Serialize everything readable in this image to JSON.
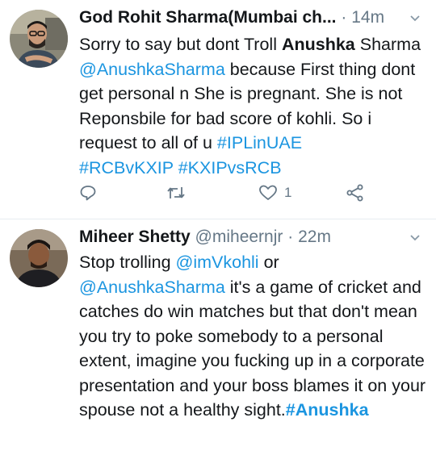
{
  "tweets": [
    {
      "name": "God Rohit Sharma(Mumbai ch...",
      "time": "14m",
      "separator": "·",
      "text": {
        "p1": "Sorry to say but dont Troll ",
        "bold1": "Anushka",
        "p2": " Sharma ",
        "mention1": "@AnushkaSharma",
        "p3": " because First thing dont get personal n She is pregnant. She is not Reponsbile for bad score of kohli. So i request to all of u ",
        "hashtag1": "#IPLinUAE",
        "hashtag2": "#RCBvKXIP",
        "hashtag3": "#KXIPvsRCB"
      },
      "actions": {
        "reply_icon": "reply-icon",
        "retweet_icon": "retweet-icon",
        "like_icon": "heart-icon",
        "like_count": "1",
        "share_icon": "share-icon"
      }
    },
    {
      "name": "Miheer Shetty",
      "handle": "@miheernjr",
      "separator": "·",
      "time": "22m",
      "text": {
        "p1": "Stop trolling ",
        "mention1": "@imVkohli",
        "p2": "  or ",
        "mention2": "@AnushkaSharma",
        "p3": " it's a game of cricket and catches do  win matches but that don't mean you try to poke somebody to a personal extent, imagine you fucking up in a corporate presentation and your boss blames it on your spouse not a healthy sight.",
        "hashtag1": "#Anushka"
      }
    }
  ],
  "colors": {
    "link": "#1b95e0",
    "secondary": "#657786",
    "text": "#14171a"
  }
}
